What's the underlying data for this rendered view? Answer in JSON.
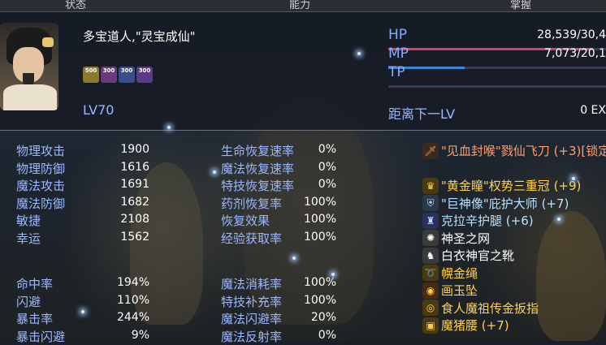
{
  "tabs": [
    "状态",
    "能力",
    "掌握"
  ],
  "character": {
    "name": "多宝道人,\"灵宝成仙\"",
    "level": "LV70",
    "buffs": [
      {
        "label": "500",
        "color": "#8b7a2e"
      },
      {
        "label": "300",
        "color": "#6b3a7e"
      },
      {
        "label": "300",
        "color": "#3a4e8e"
      },
      {
        "label": "300",
        "color": "#5a3a8a"
      }
    ]
  },
  "bars": {
    "hp": {
      "label": "HP",
      "value": "28,539/30,4",
      "fill": 0.94,
      "color": "#d04470"
    },
    "mp": {
      "label": "MP",
      "value": "7,073/20,1",
      "fill": 0.35,
      "color": "#3a86d8"
    },
    "tp": {
      "label": "TP",
      "value": "",
      "fill": 0.0,
      "color": "#3aaa60"
    },
    "exp_label": "距离下一LV",
    "exp_value": "0 EX"
  },
  "stats_left": [
    {
      "label": "物理攻击",
      "value": "1900"
    },
    {
      "label": "物理防御",
      "value": "1616"
    },
    {
      "label": "魔法攻击",
      "value": "1691"
    },
    {
      "label": "魔法防御",
      "value": "1682"
    },
    {
      "label": "敏捷",
      "value": "2108"
    },
    {
      "label": "幸运",
      "value": "1562"
    },
    {
      "label": "命中率",
      "value": "194%"
    },
    {
      "label": "闪避",
      "value": "110%"
    },
    {
      "label": "暴击率",
      "value": "244%"
    },
    {
      "label": "暴击闪避",
      "value": "9%"
    }
  ],
  "stats_mid": [
    {
      "label": "生命恢复速率",
      "value": "0%"
    },
    {
      "label": "魔法恢复速率",
      "value": "0%"
    },
    {
      "label": "特技恢复速率",
      "value": "0%"
    },
    {
      "label": "药剂恢复率",
      "value": "100%"
    },
    {
      "label": "恢复效果",
      "value": "100%"
    },
    {
      "label": "经验获取率",
      "value": "100%"
    },
    {
      "label": "魔法消耗率",
      "value": "100%"
    },
    {
      "label": "特技补充率",
      "value": "100%"
    },
    {
      "label": "魔法闪避率",
      "value": "20%"
    },
    {
      "label": "魔法反射率",
      "value": "0%"
    }
  ],
  "equipment": [
    {
      "name": "\"见血封喉\"戮仙飞刀 (+3)[锁定]",
      "icon": "dagger-icon",
      "glyph": "🗡",
      "color": "#ff9f6a",
      "iconbg": "#3a2a20"
    },
    {
      "name": "\"黄金瞳\"权势三重冠 (+9)",
      "icon": "crown-icon",
      "glyph": "♛",
      "color": "#ffd24a",
      "iconbg": "#4a3a10"
    },
    {
      "name": "\"巨神像\"庇护大师 (+7)",
      "icon": "shield-icon",
      "glyph": "⛨",
      "color": "#b9e2ff",
      "iconbg": "#2a3a4a"
    },
    {
      "name": "克拉辛护腿 (+6)",
      "icon": "greaves-icon",
      "glyph": "♜",
      "color": "#b9e2ff",
      "iconbg": "#2a3060"
    },
    {
      "name": "神圣之网",
      "icon": "net-icon",
      "glyph": "✺",
      "color": "#ffffff",
      "iconbg": "#3a3a3a"
    },
    {
      "name": "白衣神官之靴",
      "icon": "boots-icon",
      "glyph": "♞",
      "color": "#ffffff",
      "iconbg": "#3a3a3a"
    },
    {
      "name": "幌金绳",
      "icon": "rope-icon",
      "glyph": "➰",
      "color": "#ffd24a",
      "iconbg": "#4a3a10"
    },
    {
      "name": "画玉坠",
      "icon": "pendant-icon",
      "glyph": "◉",
      "color": "#ffd24a",
      "iconbg": "#4a2a10"
    },
    {
      "name": "食人魔祖传金扳指",
      "icon": "ring-icon",
      "glyph": "◎",
      "color": "#ffd24a",
      "iconbg": "#4a3a10"
    },
    {
      "name": "魔猪腰 (+7)",
      "icon": "belt-icon",
      "glyph": "▣",
      "color": "#ffd24a",
      "iconbg": "#4a3a10"
    }
  ]
}
